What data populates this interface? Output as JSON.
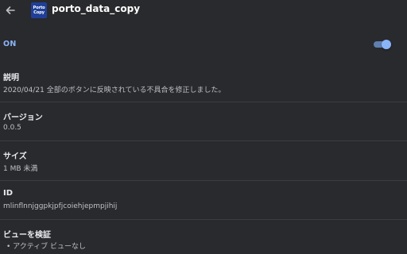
{
  "header": {
    "title": "porto_data_copy",
    "logo_line1": "Porto",
    "logo_line2": "Copy",
    "back_icon": "arrow-left-icon"
  },
  "toggle_row": {
    "label": "ON",
    "enabled": true,
    "accent": "#8ab4f8"
  },
  "details": {
    "description_label": "説明",
    "description_value": "2020/04/21 全部のボタンに反映されている不具合を修正しました。",
    "version_label": "バージョン",
    "version_value": "0.0.5",
    "size_label": "サイズ",
    "size_value": "1 MB 未満",
    "id_label": "ID",
    "id_value": "mlinflnnjggpkjpfjcoiehjepmpjihij",
    "inspect_label": "ビューを検証",
    "inspect_items": [
      "• アクティブ ビューなし"
    ]
  },
  "colors": {
    "background": "#292a2d",
    "divider": "#3c3d40",
    "text": "#e8eaed",
    "secondary_text": "#bdc1c6"
  }
}
